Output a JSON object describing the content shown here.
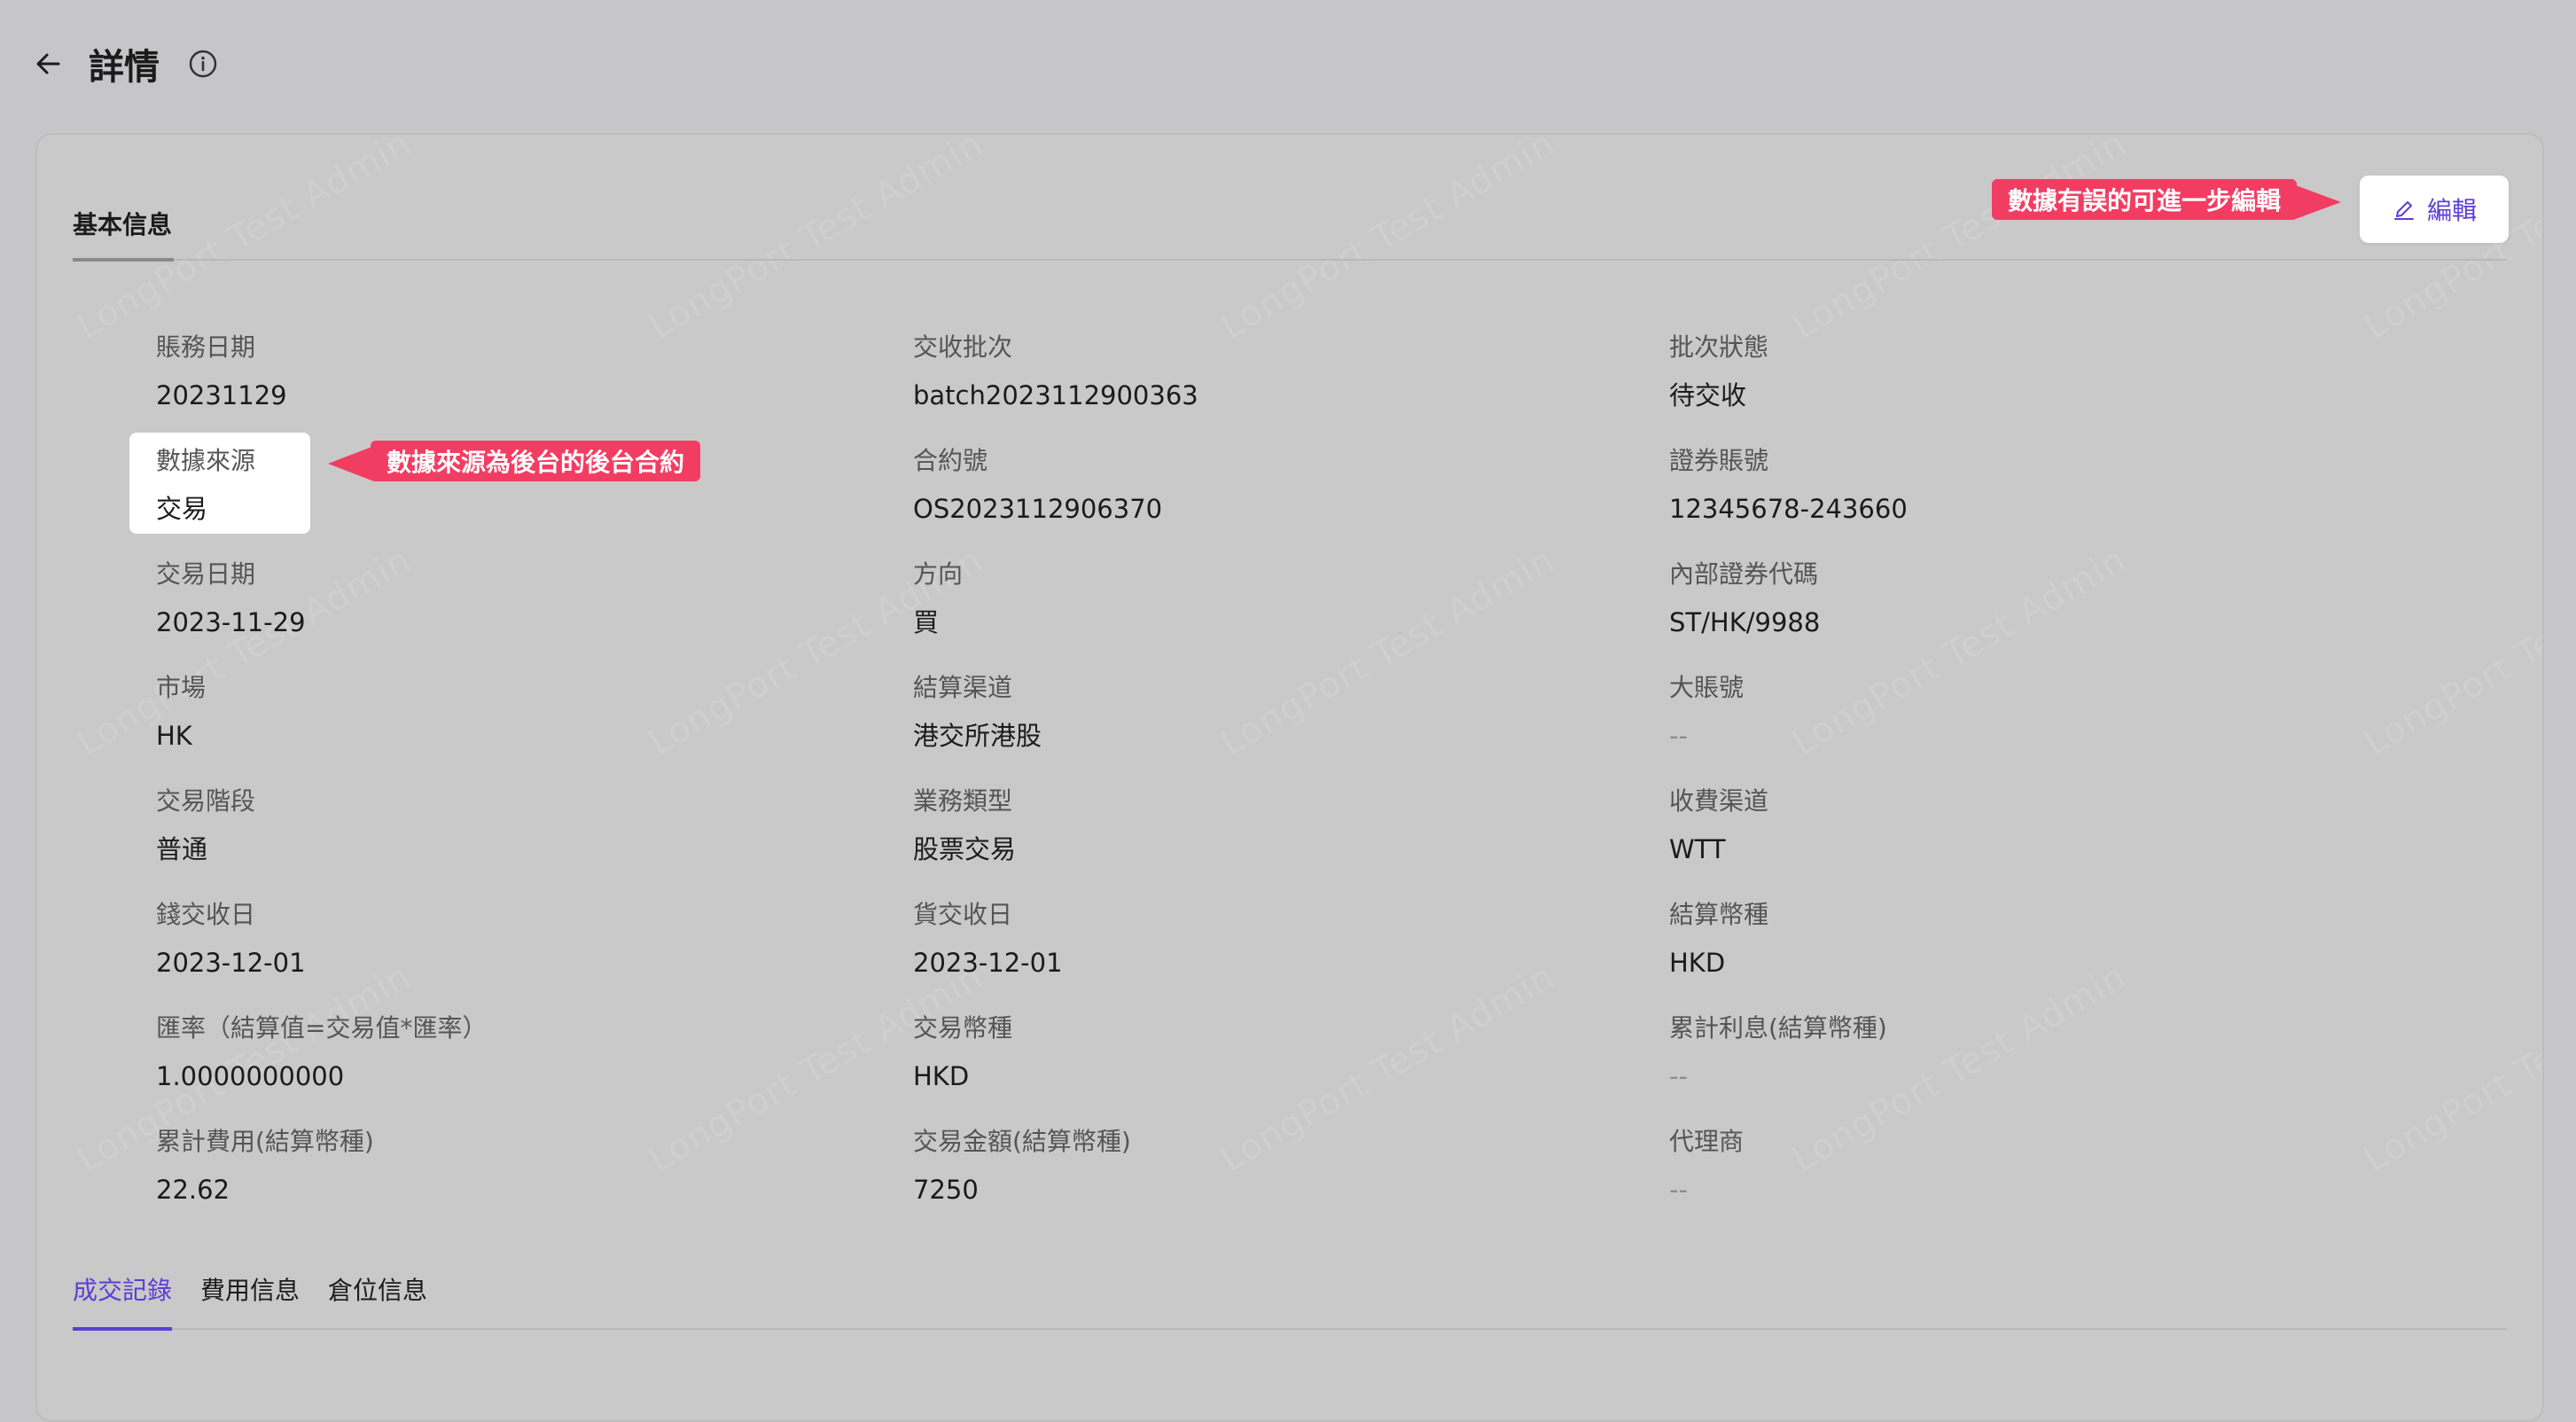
{
  "header": {
    "title": "詳情"
  },
  "watermark": "LongPort Test Admin",
  "tabs_top": {
    "basic": "基本信息"
  },
  "edit_button": {
    "label": "編輯"
  },
  "callouts": {
    "edit": "數據有誤的可進一步編輯",
    "source": "數據來源為後台的後台合約"
  },
  "fields": [
    {
      "label": "賬務日期",
      "value": "20231129"
    },
    {
      "label": "交收批次",
      "value": "batch2023112900363"
    },
    {
      "label": "批次狀態",
      "value": "待交收"
    },
    {
      "label": "數據來源",
      "value": "交易"
    },
    {
      "label": "合約號",
      "value": "OS2023112906370"
    },
    {
      "label": "證券賬號",
      "value": "12345678-243660"
    },
    {
      "label": "交易日期",
      "value": "2023-11-29"
    },
    {
      "label": "方向",
      "value": "買"
    },
    {
      "label": "內部證券代碼",
      "value": "ST/HK/9988"
    },
    {
      "label": "市場",
      "value": "HK"
    },
    {
      "label": "結算渠道",
      "value": "港交所港股"
    },
    {
      "label": "大賬號",
      "value": "--"
    },
    {
      "label": "交易階段",
      "value": "普通"
    },
    {
      "label": "業務類型",
      "value": "股票交易"
    },
    {
      "label": "收費渠道",
      "value": "WTT"
    },
    {
      "label": "錢交收日",
      "value": "2023-12-01"
    },
    {
      "label": "貨交收日",
      "value": "2023-12-01"
    },
    {
      "label": "結算幣種",
      "value": "HKD"
    },
    {
      "label": "匯率（結算值=交易值*匯率）",
      "value": "1.0000000000"
    },
    {
      "label": "交易幣種",
      "value": "HKD"
    },
    {
      "label": "累計利息(結算幣種)",
      "value": "--"
    },
    {
      "label": "累計費用(結算幣種)",
      "value": "22.62"
    },
    {
      "label": "交易金額(結算幣種)",
      "value": "7250"
    },
    {
      "label": "代理商",
      "value": "--"
    }
  ],
  "tabs_bottom": [
    {
      "label": "成交記錄",
      "active": true
    },
    {
      "label": "費用信息",
      "active": false
    },
    {
      "label": "倉位信息",
      "active": false
    }
  ],
  "colors": {
    "accent": "#5b3fd6",
    "callout": "#f23d62"
  }
}
